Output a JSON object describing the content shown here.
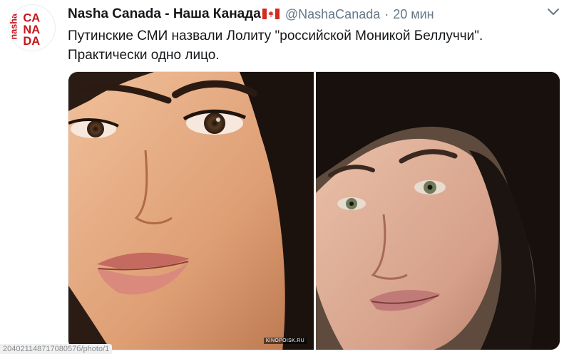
{
  "tweet": {
    "avatar_text": {
      "line1": "nasha",
      "line2": "CANADA"
    },
    "display_name": "Nasha Canada - Наша Канада",
    "flag_emoji": "canada-flag-icon",
    "handle": "@NashaCanada",
    "separator": "·",
    "time": "20 мин",
    "text_line1": "Путинские СМИ назвали Лолиту \"российской Моникой Беллуччи\".",
    "text_line2": "Практически одно лицо.",
    "media": {
      "left_watermark": "KINOPOISK.RU",
      "left_photo_name": "photo-left",
      "right_photo_name": "photo-right"
    }
  },
  "status_bar": {
    "url": "20402114871708057б/photo/1"
  },
  "colors": {
    "accent_red": "#e0245e",
    "text_primary": "#14171a",
    "text_secondary": "#657786",
    "border": "#e1e8ed"
  }
}
